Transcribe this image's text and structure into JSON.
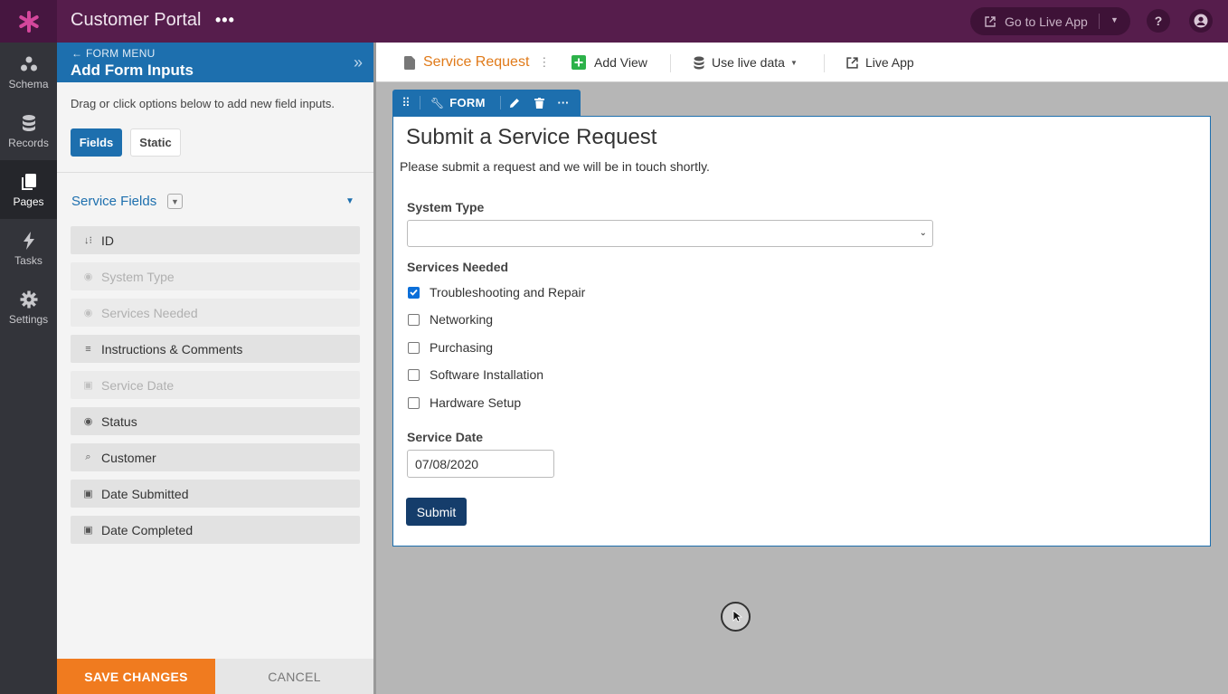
{
  "app": {
    "title": "Customer Portal",
    "more_icon": "more-horizontal-icon"
  },
  "topbar": {
    "go_live_label": "Go to Live App",
    "help_icon": "help-icon",
    "account_icon": "account-icon"
  },
  "nav": [
    {
      "label": "Schema",
      "icon": "schema-icon"
    },
    {
      "label": "Records",
      "icon": "database-icon"
    },
    {
      "label": "Pages",
      "icon": "pages-icon",
      "active": true
    },
    {
      "label": "Tasks",
      "icon": "bolt-icon"
    },
    {
      "label": "Settings",
      "icon": "gear-icon"
    }
  ],
  "panel": {
    "back_label": "FORM MENU",
    "title": "Add Form Inputs",
    "description": "Drag or click options below to add new field inputs.",
    "tabs": [
      "Fields",
      "Static"
    ],
    "section_title": "Service Fields",
    "fields": [
      {
        "label": "ID",
        "icon": "sort-numeric-icon",
        "disabled": false
      },
      {
        "label": "System Type",
        "icon": "radio-icon",
        "disabled": true
      },
      {
        "label": "Services Needed",
        "icon": "radio-icon",
        "disabled": true
      },
      {
        "label": "Instructions & Comments",
        "icon": "paragraph-icon",
        "disabled": false
      },
      {
        "label": "Service Date",
        "icon": "calendar-clock-icon",
        "disabled": true
      },
      {
        "label": "Status",
        "icon": "radio-icon",
        "disabled": false
      },
      {
        "label": "Customer",
        "icon": "search-connection-icon",
        "disabled": false
      },
      {
        "label": "Date Submitted",
        "icon": "calendar-clock-icon",
        "disabled": false
      },
      {
        "label": "Date Completed",
        "icon": "calendar-clock-icon",
        "disabled": false
      }
    ],
    "save_label": "SAVE CHANGES",
    "cancel_label": "CANCEL"
  },
  "viewbar": {
    "page_name": "Service Request",
    "add_view_label": "Add View",
    "live_data_label": "Use live data",
    "live_app_label": "Live App"
  },
  "form": {
    "tab_label": "FORM",
    "title": "Submit a Service Request",
    "description": "Please submit a request and we will be in touch shortly.",
    "system_type_label": "System Type",
    "system_type_value": "",
    "services_label": "Services Needed",
    "services": [
      {
        "label": "Troubleshooting and Repair",
        "checked": true
      },
      {
        "label": "Networking",
        "checked": false
      },
      {
        "label": "Purchasing",
        "checked": false
      },
      {
        "label": "Software Installation",
        "checked": false
      },
      {
        "label": "Hardware Setup",
        "checked": false
      }
    ],
    "service_date_label": "Service Date",
    "service_date_value": "07/08/2020",
    "submit_label": "Submit"
  },
  "colors": {
    "topbar": "#561d4c",
    "panel_header": "#1d6fae",
    "accent_orange": "#f07b1f",
    "submit": "#153d6b"
  }
}
